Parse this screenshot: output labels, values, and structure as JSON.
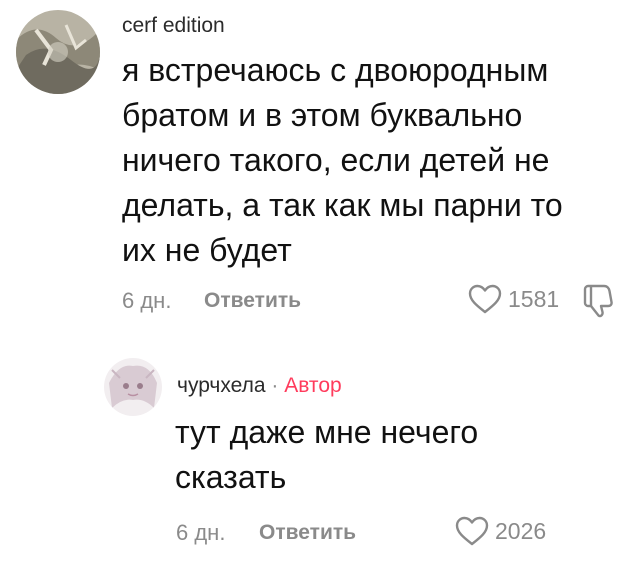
{
  "comments": [
    {
      "username": "cerf edition",
      "text": "я встречаюсь с двоюродным\nбратом и в этом буквально\nничего такого, если детей не\nделать, а так как мы парни то\nих не будет",
      "time": "6 дн.",
      "reply_label": "Ответить",
      "likes": "1581",
      "avatar_icon": "avatar-photo",
      "dislike_icon": "dislike-icon"
    },
    {
      "username": "чурчхела",
      "separator": "·",
      "author_badge": "Автор",
      "text": "тут даже мне нечего\nсказать",
      "time": "6 дн.",
      "reply_label": "Ответить",
      "likes": "2026",
      "avatar_icon": "avatar-anime"
    }
  ],
  "colors": {
    "text": "#111111",
    "muted": "#8a8a8a",
    "author_accent": "#ff3b5c"
  }
}
